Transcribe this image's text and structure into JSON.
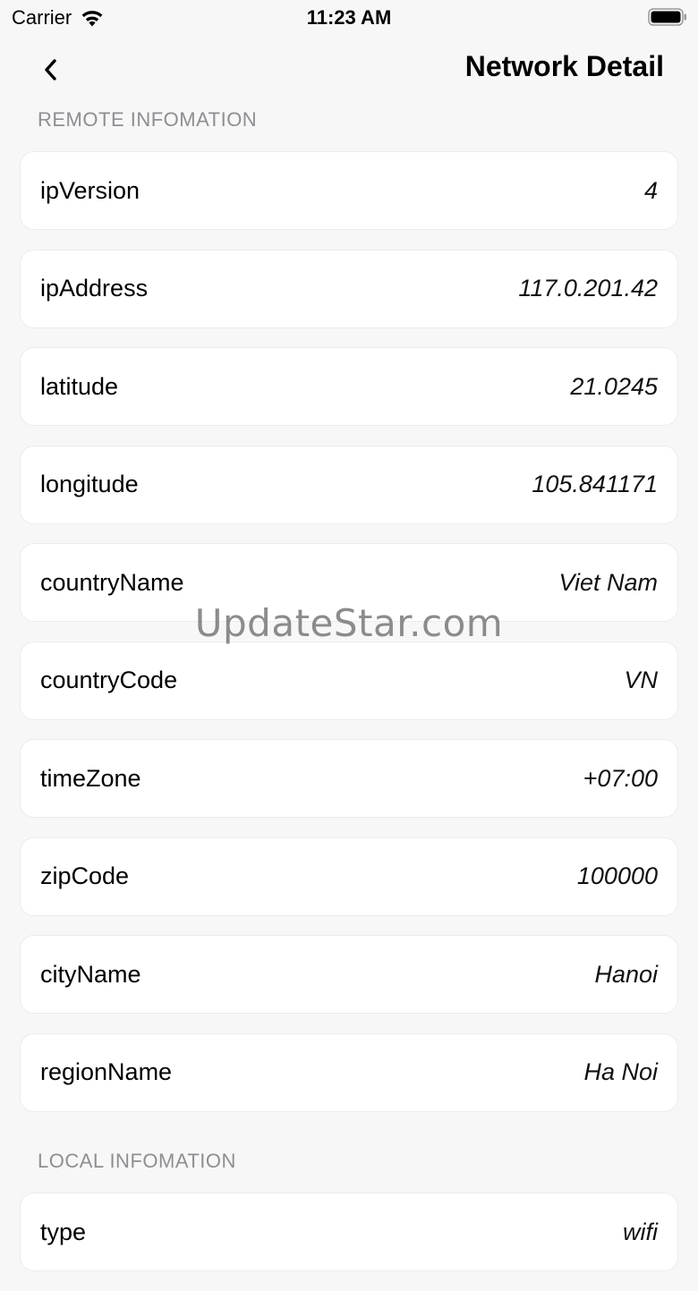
{
  "status_bar": {
    "carrier": "Carrier",
    "time": "11:23 AM"
  },
  "nav": {
    "title": "Network Detail",
    "back_icon": "chevron-left-icon"
  },
  "remote": {
    "header": "REMOTE INFOMATION",
    "rows": [
      {
        "label": "ipVersion",
        "value": "4"
      },
      {
        "label": "ipAddress",
        "value": "117.0.201.42"
      },
      {
        "label": "latitude",
        "value": "21.0245"
      },
      {
        "label": "longitude",
        "value": "105.841171"
      },
      {
        "label": "countryName",
        "value": "Viet Nam"
      },
      {
        "label": "countryCode",
        "value": "VN"
      },
      {
        "label": "timeZone",
        "value": "+07:00"
      },
      {
        "label": "zipCode",
        "value": "100000"
      },
      {
        "label": "cityName",
        "value": "Hanoi"
      },
      {
        "label": "regionName",
        "value": "Ha Noi"
      }
    ]
  },
  "local": {
    "header": "LOCAL INFOMATION",
    "rows": [
      {
        "label": "type",
        "value": "wifi"
      }
    ]
  },
  "watermark": "UpdateStar.com"
}
